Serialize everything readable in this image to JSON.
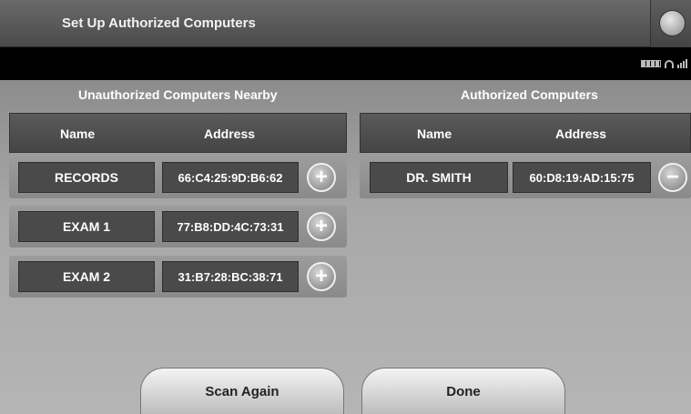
{
  "window": {
    "title": "Set Up Authorized Computers"
  },
  "unauthorized": {
    "header": "Unauthorized Computers Nearby",
    "name_col": "Name",
    "address_col": "Address",
    "rows": [
      {
        "name": "RECORDS",
        "address": "66:C4:25:9D:B6:62",
        "action": "+"
      },
      {
        "name": "EXAM 1",
        "address": "77:B8:DD:4C:73:31",
        "action": "+"
      },
      {
        "name": "EXAM 2",
        "address": "31:B7:28:BC:38:71",
        "action": "+"
      }
    ]
  },
  "authorized": {
    "header": "Authorized Computers",
    "name_col": "Name",
    "address_col": "Address",
    "rows": [
      {
        "name": "DR. SMITH",
        "address": "60:D8:19:AD:15:75",
        "action": "−"
      }
    ]
  },
  "buttons": {
    "scan_again": "Scan Again",
    "done": "Done"
  },
  "icons": {
    "title_button": "globe-icon",
    "add": "plus-icon",
    "remove": "minus-icon",
    "battery": "battery-icon",
    "wifi": "wifi-icon",
    "signal": "signal-icon"
  }
}
